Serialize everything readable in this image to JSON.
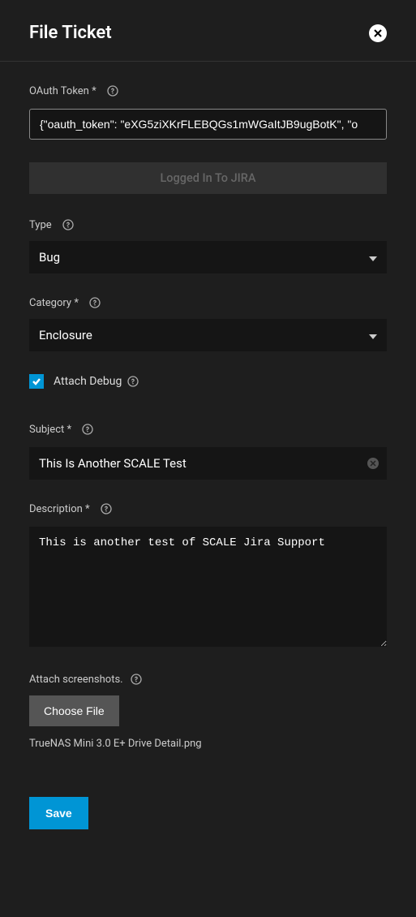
{
  "header": {
    "title": "File Ticket"
  },
  "oauth": {
    "label": "OAuth Token",
    "required": "*",
    "value": "{\"oauth_token\": \"eXG5ziXKrFLEBQGs1mWGaItJB9ugBotK\", \"o"
  },
  "status": {
    "text": "Logged In To JIRA"
  },
  "type": {
    "label": "Type",
    "value": "Bug"
  },
  "category": {
    "label": "Category",
    "required": "*",
    "value": "Enclosure"
  },
  "attach_debug": {
    "label": "Attach Debug",
    "checked": true
  },
  "subject": {
    "label": "Subject",
    "required": "*",
    "value": "This Is Another SCALE Test"
  },
  "description": {
    "label": "Description",
    "required": "*",
    "value": "This is another test of SCALE Jira Support"
  },
  "screenshots": {
    "label": "Attach screenshots.",
    "button": "Choose File",
    "filename": "TrueNAS Mini 3.0 E+ Drive Detail.png"
  },
  "actions": {
    "save": "Save"
  }
}
